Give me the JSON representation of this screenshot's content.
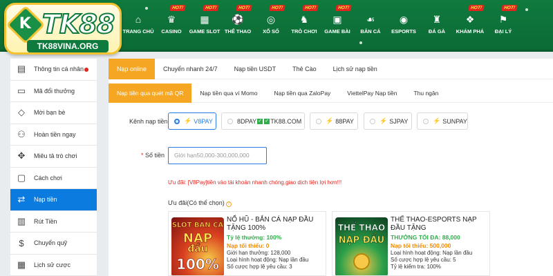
{
  "logo": {
    "mark": "K",
    "text": "TK88",
    "sub": "TK88VINA.ORG"
  },
  "nav": {
    "hot_label": "HOT!",
    "items": [
      {
        "label": "TRANG CHỦ",
        "icon": "home-icon",
        "glyph": "⌂",
        "hot": false
      },
      {
        "label": "CASINO",
        "icon": "casino-icon",
        "glyph": "♛",
        "hot": true
      },
      {
        "label": "GAME SLOT",
        "icon": "slot-icon",
        "glyph": "▦",
        "hot": true
      },
      {
        "label": "THỂ THAO",
        "icon": "sports-icon",
        "glyph": "⚽",
        "hot": true
      },
      {
        "label": "XỔ SỐ",
        "icon": "lottery-icon",
        "glyph": "◎",
        "hot": true
      },
      {
        "label": "TRÒ CHƠI",
        "icon": "chess-icon",
        "glyph": "♞",
        "hot": true
      },
      {
        "label": "GAME BÀI",
        "icon": "cards-icon",
        "glyph": "▣",
        "hot": true
      },
      {
        "label": "BẮN CÁ",
        "icon": "fish-icon",
        "glyph": "☙",
        "hot": false
      },
      {
        "label": "ESPORTS",
        "icon": "gamepad-icon",
        "glyph": "◉",
        "hot": false
      },
      {
        "label": "ĐÁ GÀ",
        "icon": "rooster-icon",
        "glyph": "♜",
        "hot": false
      },
      {
        "label": "KHÁM PHÁ",
        "icon": "gift-icon",
        "glyph": "❖",
        "hot": true
      },
      {
        "label": "ĐẠI LÝ",
        "icon": "agent-icon",
        "glyph": "⚑",
        "hot": true
      }
    ]
  },
  "sidebar": {
    "items": [
      {
        "label": "Thông tin cá nhân",
        "icon": "user-card-icon",
        "glyph": "▤",
        "dot": true
      },
      {
        "label": "Mã đổi thưởng",
        "icon": "ticket-icon",
        "glyph": "▭",
        "dot": false
      },
      {
        "label": "Mời bạn bè",
        "icon": "diamond-icon",
        "glyph": "◇",
        "dot": false
      },
      {
        "label": "Hoàn tiền ngay",
        "icon": "refund-icon",
        "glyph": "⚇",
        "dot": false
      },
      {
        "label": "Miêu tả trò chơi",
        "icon": "gamepad-icon",
        "glyph": "✥",
        "dot": false
      },
      {
        "label": "Cách chơi",
        "icon": "guide-icon",
        "glyph": "▢",
        "dot": false
      },
      {
        "label": "Nạp tiền",
        "icon": "deposit-icon",
        "glyph": "⇄",
        "dot": false,
        "active": true
      },
      {
        "label": "Rút Tiền",
        "icon": "withdraw-icon",
        "glyph": "▥",
        "dot": false
      },
      {
        "label": "Chuyển quỹ",
        "icon": "dollar-icon",
        "glyph": "$",
        "dot": false
      },
      {
        "label": "Lịch sử cược",
        "icon": "history-icon",
        "glyph": "▦",
        "dot": false
      }
    ]
  },
  "tabs_primary": [
    "Nạp online",
    "Chuyển nhanh 24/7",
    "Nạp tiền USDT",
    "Thẻ Cào",
    "Lịch sử nạp tiền"
  ],
  "tabs_secondary": [
    "Nạp tiền qua quét mã QR",
    "Nạp tiền qua ví Momo",
    "Nạp tiền qua ZaloPay",
    "ViettelPay Nạp tiền",
    "Thu ngân"
  ],
  "channel": {
    "label": "Kênh nạp tiền",
    "options": [
      {
        "label": "V8PAY",
        "selected": true
      },
      {
        "label_a": "8DPAY",
        "label_b": "TK88.COM",
        "selected": false
      },
      {
        "label": "88PAY",
        "selected": false
      },
      {
        "label": "SJPAY",
        "selected": false
      },
      {
        "label": "SUNPAY",
        "selected": false
      }
    ]
  },
  "amount": {
    "required_mark": "*",
    "label": "Số tiền",
    "placeholder": "Giới hạn50,000-300,000,000"
  },
  "promo_text": "Ưu đãi:  [V8Pay]tiền vào tài khoản nhanh chóng,giao dịch tiện lợi hơn!!!",
  "offers": {
    "title": "Ưu đãi(Có thể chọn)",
    "help_glyph": "?",
    "cards": [
      {
        "title": "NỔ HŨ - BẮN CÁ NẠP ĐẦU TẶNG 100%",
        "green": "Tỷ lệ thưởng: 100%",
        "orange": "Nạp tối thiểu: 0",
        "lines": [
          "Giới hạn thưởng: 128,000",
          "Loại hình hoạt động: Nạp lần đầu",
          "Số cược hợp lệ yêu cầu: 3"
        ],
        "img_lines": [
          "SLOT BẮN CÁ",
          "NẠP",
          "đầu",
          "100%"
        ]
      },
      {
        "title": "THỂ THAO-ESPORTS NẠP ĐẦU TẶNG",
        "green": "THƯỞNG TỐI ĐA: 88,000",
        "orange": "Nạp tối thiểu: 500,000",
        "lines": [
          "Loại hình hoạt động: Nạp lần đầu",
          "Số cược hợp lệ yêu cầu: 5",
          "Tỷ lệ kiểm tra: 100%"
        ],
        "img_lines": [
          "THỂ THAO",
          "NẠP ĐẦU"
        ]
      }
    ]
  },
  "colors": {
    "nav_green": "#0f7a3e",
    "accent_orange": "#f5a623",
    "active_blue": "#0c7be0",
    "link_blue": "#2a7de1"
  }
}
